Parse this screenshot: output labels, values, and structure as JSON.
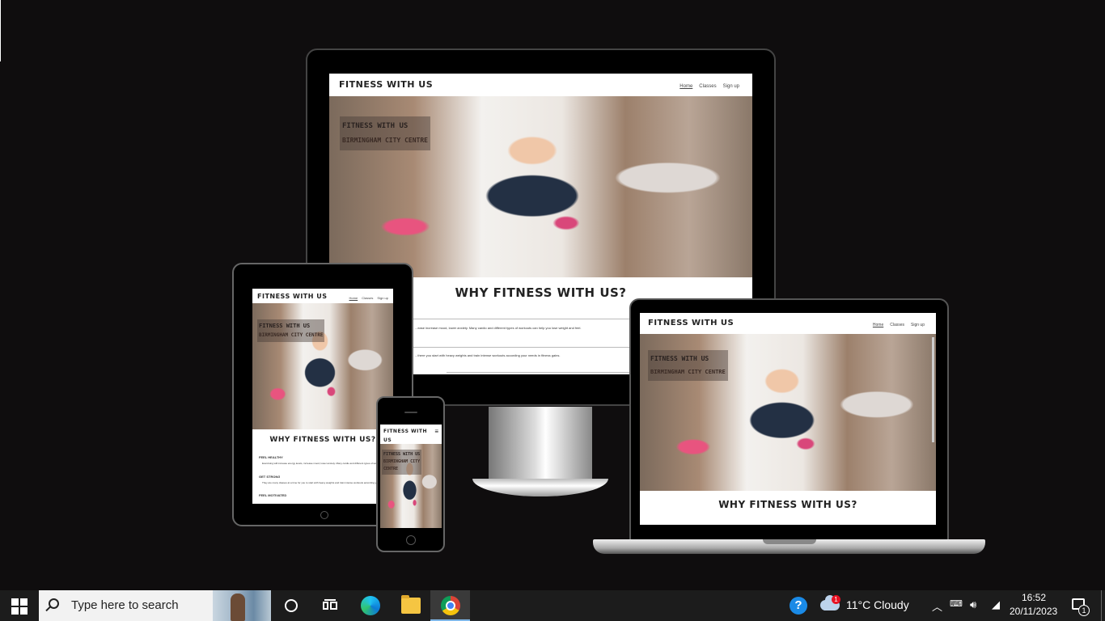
{
  "website": {
    "logo": "FITNESS WITH US",
    "logo_phone_line1": "FITNESS WITH",
    "logo_phone_line2": "US",
    "nav": [
      "Home",
      "Classes",
      "Sign up"
    ],
    "hero_line1": "FITNESS WITH US",
    "hero_line2": "BIRMINGHAM CITY CENTRE",
    "hero_phone_line2": "BIRMINGHAM CITY",
    "hero_phone_line3": "CENTRE",
    "heading": "WHY FITNESS WITH US?",
    "sections": [
      {
        "title": "FEEL HEALTHY",
        "text": "Exercising will increase energy levels, increase mood, lower anxiety. Many cardio and different types of workouts can help you lose weight and feel."
      },
      {
        "title": "GET STRONG",
        "text": "They are many classes at a time for you to start with heavy weights and train intense workouts according your needs in fitness gains."
      },
      {
        "title": "FEEL MOTIVATED",
        "text": ""
      }
    ],
    "monitor_text1": "...ease increase mood, lower anxiety. Many cardio and different types of workouts can help you lose weight and feel.",
    "monitor_text2": "...there you start with heavy weights and train intense workouts according your needs in fitness gains."
  },
  "taskbar": {
    "search_placeholder": "Type here to search",
    "help_label": "?",
    "weather_badge": "1",
    "weather_text": "11°C  Cloudy",
    "clock_time": "16:52",
    "clock_date": "20/11/2023",
    "notifications_count": "1",
    "icons": [
      "windows-start-icon",
      "search-icon",
      "cortana-icon",
      "task-view-icon",
      "edge-icon",
      "file-explorer-icon",
      "chrome-icon",
      "help-icon",
      "weather-cloud-icon",
      "chevron-up-icon",
      "ime-icon",
      "volume-icon",
      "network-icon",
      "notification-icon"
    ]
  },
  "colors": {
    "background": "#0f0d0e",
    "taskbar": "#1c1c1c",
    "accent": "#7fb7e8"
  }
}
